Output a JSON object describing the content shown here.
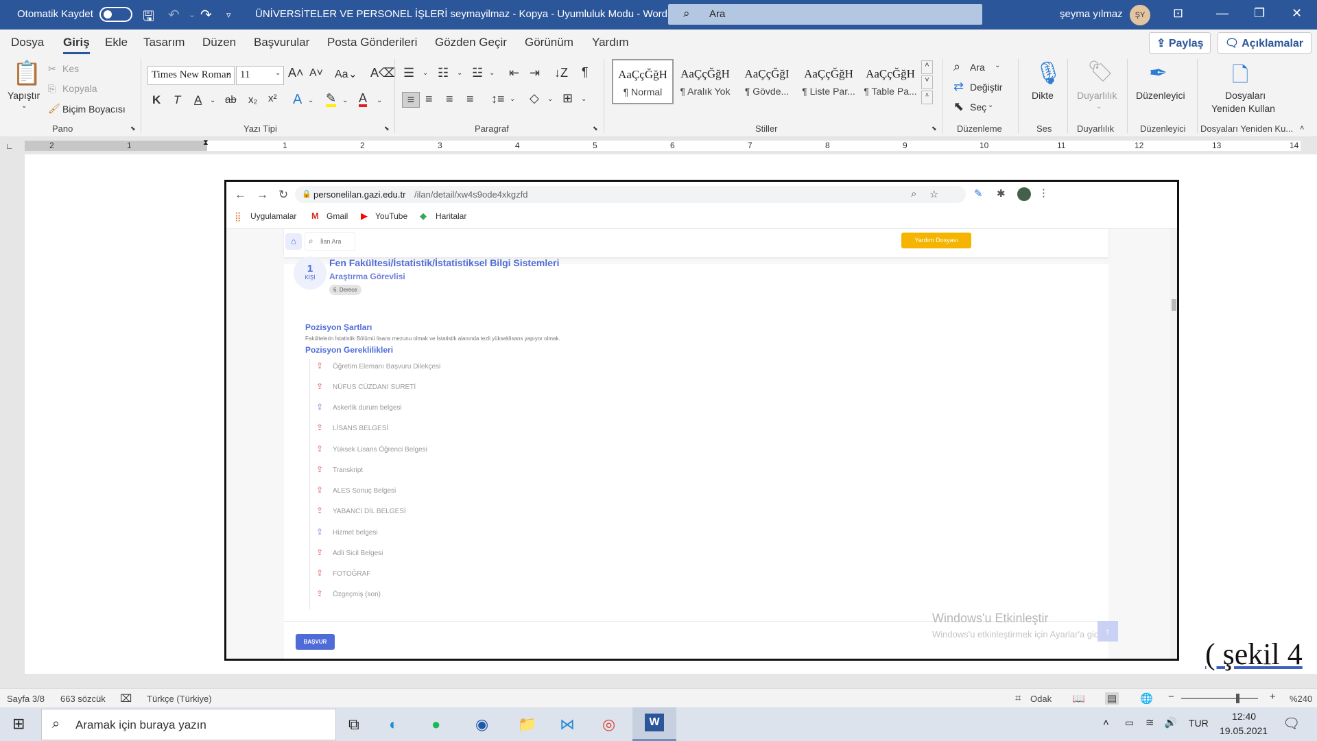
{
  "titlebar": {
    "autosave": "Otomatik Kaydet",
    "doc_title": "ÜNİVERSİTELER VE PERSONEL İŞLERİ seymayilmaz - Kopya  -  Uyumluluk Modu  -  Word",
    "search_placeholder": "Ara",
    "user": "şeyma yılmaz",
    "avatar": "ŞY"
  },
  "menu": {
    "items": [
      "Dosya",
      "Giriş",
      "Ekle",
      "Tasarım",
      "Düzen",
      "Başvurular",
      "Posta Gönderileri",
      "Gözden Geçir",
      "Görünüm",
      "Yardım"
    ],
    "share": "Paylaş",
    "comments": "Açıklamalar"
  },
  "ribbon": {
    "clipboard": {
      "paste": "Yapıştır",
      "cut": "Kes",
      "copy": "Kopyala",
      "format_painter": "Biçim Boyacısı",
      "group": "Pano"
    },
    "font": {
      "name": "Times New Roman",
      "size": "11",
      "group": "Yazı Tipi"
    },
    "paragraph": {
      "group": "Paragraf"
    },
    "styles": {
      "items": [
        {
          "preview": "AaÇçĞğH",
          "name": "¶ Normal"
        },
        {
          "preview": "AaÇçĞğH",
          "name": "¶ Aralık Yok"
        },
        {
          "preview": "AaÇçĞğI",
          "name": "¶ Gövde..."
        },
        {
          "preview": "AaÇçĞğH",
          "name": "¶ Liste Par..."
        },
        {
          "preview": "AaÇçĞğH",
          "name": "¶ Table Pa..."
        }
      ],
      "group": "Stiller"
    },
    "editing": {
      "find": "Ara",
      "replace": "Değiştir",
      "select": "Seç",
      "group": "Düzenleme"
    },
    "voice": {
      "dictate": "Dikte",
      "group": "Ses"
    },
    "sensitivity": {
      "label": "Duyarlılık",
      "group": "Duyarlılık"
    },
    "editor": {
      "label": "Düzenleyici",
      "group": "Düzenleyici"
    },
    "reuse": {
      "label1": "Dosyaları",
      "label2": "Yeniden Kullan",
      "group": "Dosyaları Yeniden Ku..."
    }
  },
  "ruler": {
    "left": [
      "2",
      "1"
    ],
    "right": [
      "1",
      "2",
      "3",
      "4",
      "5",
      "6",
      "7",
      "8",
      "9",
      "10",
      "11",
      "12",
      "13",
      "14"
    ]
  },
  "screenshot": {
    "url_domain": "personelilan.gazi.edu.tr",
    "url_path": "/ilan/detail/xw4s9ode4xkgzfd",
    "bookmarks": [
      "Uygulamalar",
      "Gmail",
      "YouTube",
      "Haritalar"
    ],
    "search_placeholder": "İlan Ara",
    "help_button": "Yardım Dosyası",
    "count_num": "1",
    "count_unit": "KİŞİ",
    "title": "Fen Fakültesi/İstatistik/İstatistiksel Bilgi Sistemleri",
    "position": "Araştırma Görevlisi",
    "degree": "6. Derece",
    "conditions_title": "Pozisyon Şartları",
    "conditions_text": "Fakültelerin İstatistik Bölümü lisans mezunu olmak ve İstatistik alanında tezli yükseklisans yapıyor olmak.",
    "requirements_title": "Pozisyon Gereklilikleri",
    "requirements": [
      "Öğretim Elemanı Başvuru Dilekçesi",
      "NÜFUS CÜZDANI SURETİ",
      "Askerlik durum belgesi",
      "LİSANS BELGESİ",
      "Yüksek Lisans Öğrenci Belgesi",
      "Transkript",
      "ALES Sonuç Belgesi",
      "YABANCI DİL BELGESİ",
      "Hizmet belgesi",
      "Adli Sicil Belgesi",
      "FOTOĞRAF",
      "Özgeçmiş (son)"
    ],
    "apply_button": "BAŞVUR",
    "watermark_title": "Windows'u Etkinleştir",
    "watermark_text": "Windows'u etkinleştirmek için Ayarlar'a gidin."
  },
  "caption": "( şekil 4",
  "statusbar": {
    "page": "Sayfa 3/8",
    "words": "663 sözcük",
    "language": "Türkçe (Türkiye)",
    "focus": "Odak",
    "zoom": "%240"
  },
  "taskbar": {
    "search_placeholder": "Aramak için buraya yazın",
    "lang": "TUR",
    "time": "12:40",
    "date": "19.05.2021"
  }
}
